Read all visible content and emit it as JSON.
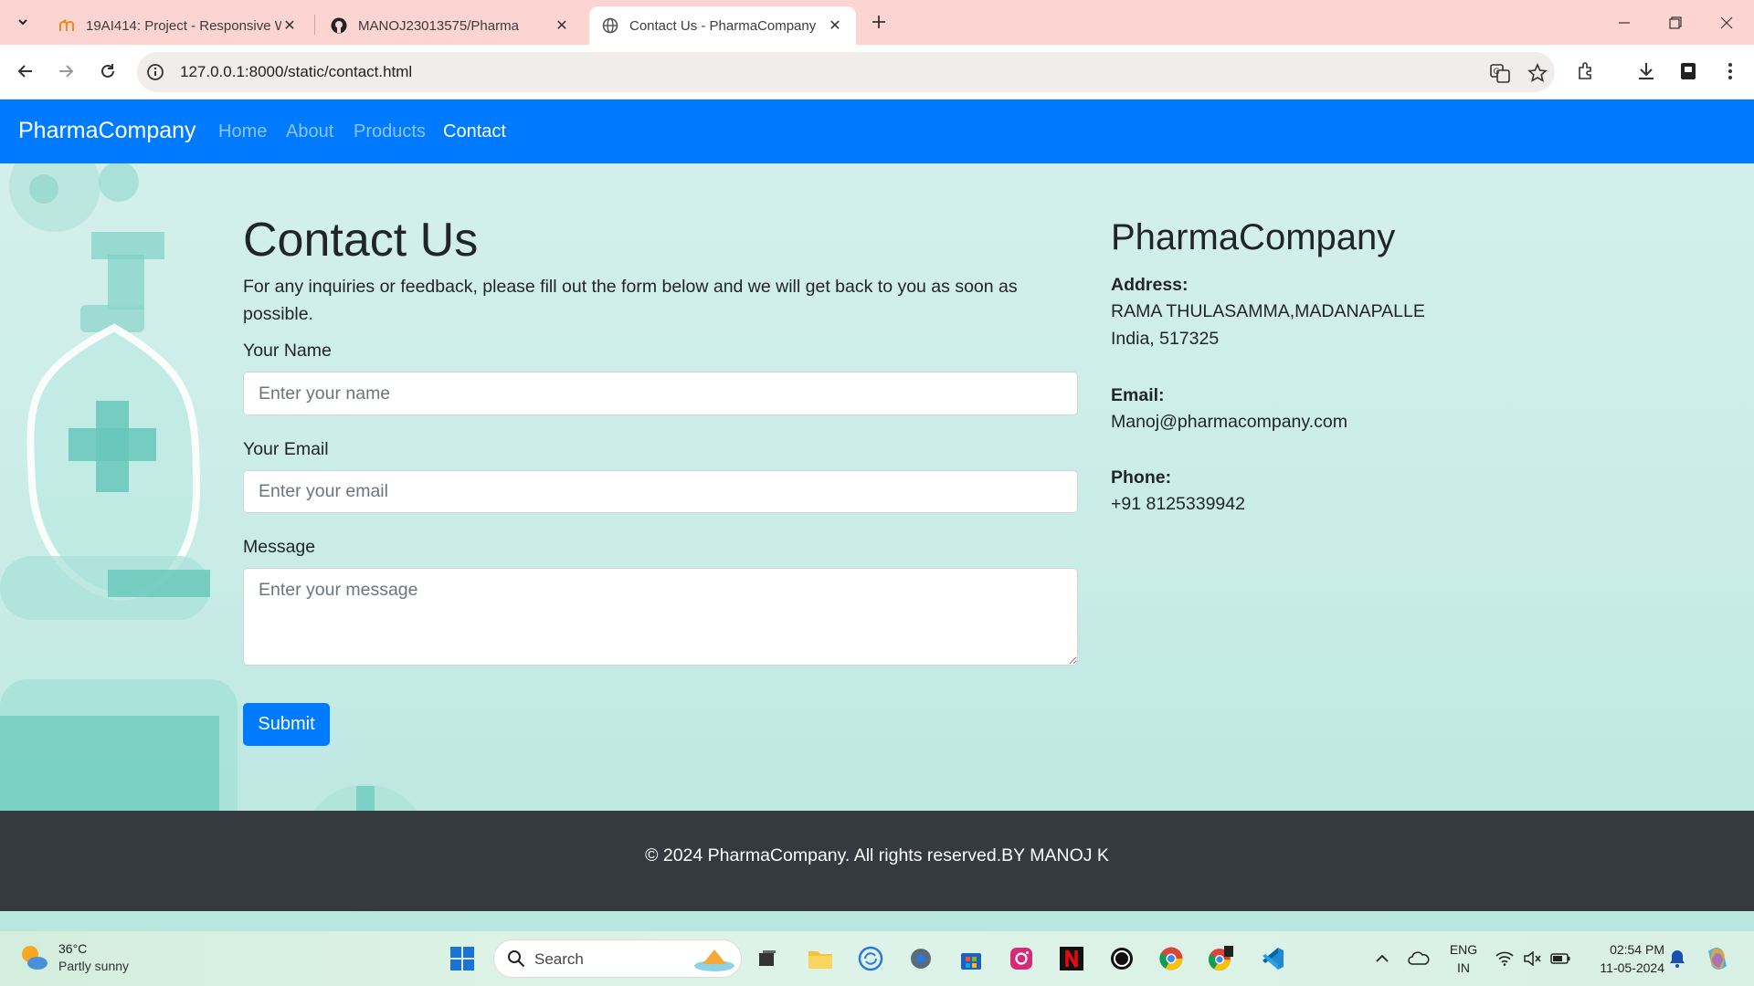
{
  "browser": {
    "tabs": [
      {
        "title": "19AI414: Project - Responsive W",
        "active": false
      },
      {
        "title": "MANOJ23013575/Pharma",
        "active": false
      },
      {
        "title": "Contact Us - PharmaCompany",
        "active": true
      }
    ],
    "url": "127.0.0.1:8000/static/contact.html"
  },
  "navbar": {
    "brand": "PharmaCompany",
    "links": [
      "Home",
      "About",
      "Products",
      "Contact"
    ],
    "active": "Contact"
  },
  "contact": {
    "title": "Contact Us",
    "intro": "For any inquiries or feedback, please fill out the form below and we will get back to you as soon as possible.",
    "name_label": "Your Name",
    "name_placeholder": "Enter your name",
    "email_label": "Your Email",
    "email_placeholder": "Enter your email",
    "message_label": "Message",
    "message_placeholder": "Enter your message",
    "submit_label": "Submit"
  },
  "company": {
    "name": "PharmaCompany",
    "address_label": "Address:",
    "address_line1": "RAMA THULASAMMA,MADANAPALLE",
    "address_line2": "India, 517325",
    "email_label": "Email:",
    "email": "Manoj@pharmacompany.com",
    "phone_label": "Phone:",
    "phone": "+91 8125339942"
  },
  "footer": {
    "text": "© 2024 PharmaCompany. All rights reserved.BY MANOJ K"
  },
  "taskbar": {
    "temperature": "36°C",
    "condition": "Partly sunny",
    "search_label": "Search",
    "lang_line1": "ENG",
    "lang_line2": "IN",
    "time": "02:54 PM",
    "date": "11-05-2024"
  },
  "colors": {
    "primary": "#007bff",
    "footer": "#343a40",
    "page_bg": "#d5f0ec",
    "tab_strip": "#fcd5d2"
  }
}
